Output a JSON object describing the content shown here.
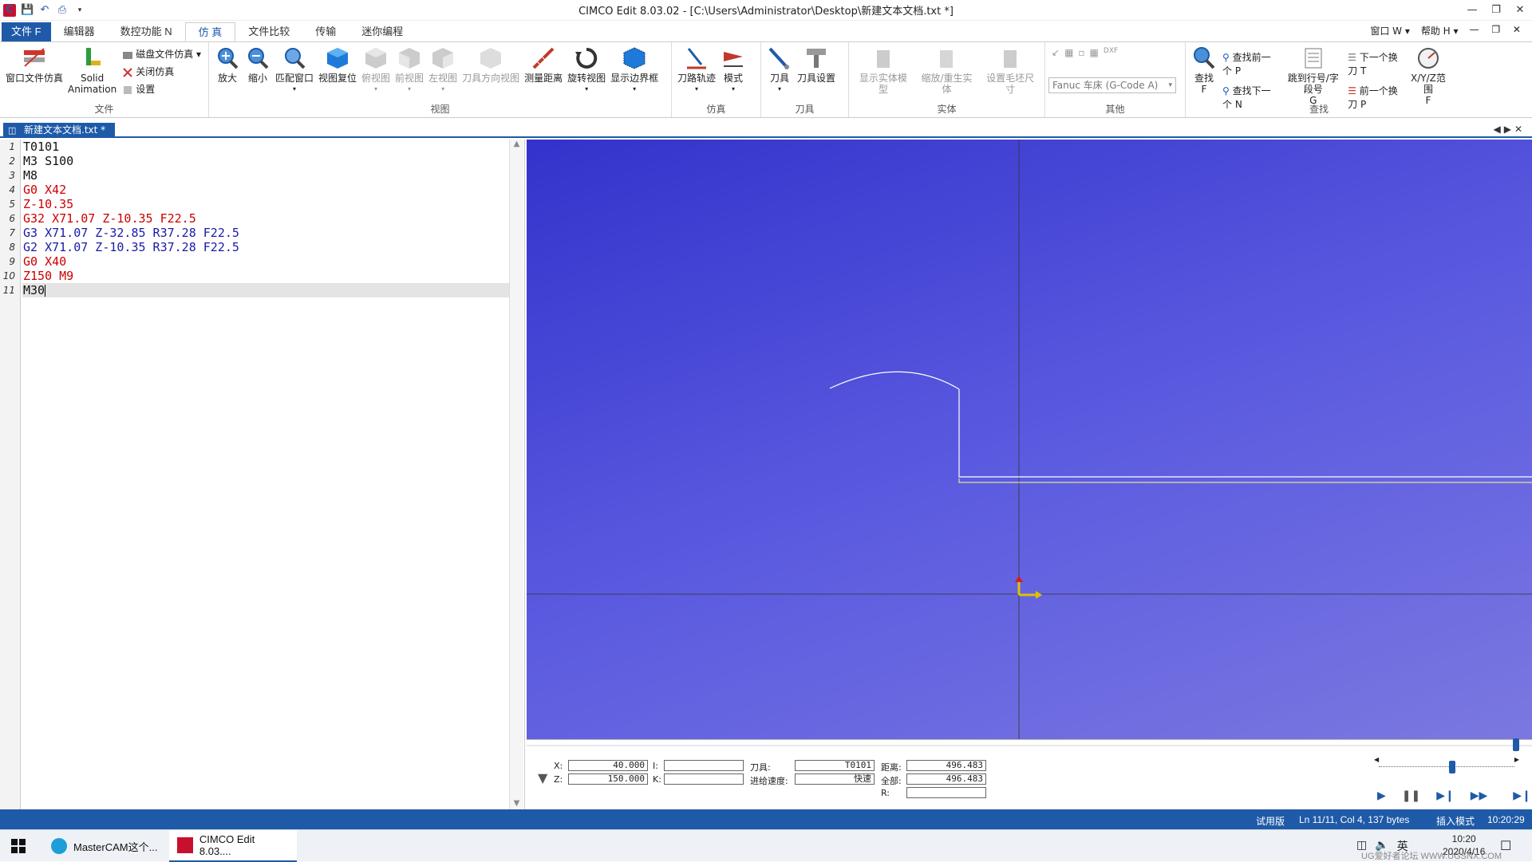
{
  "window": {
    "title": "CIMCO Edit 8.03.02 - [C:\\Users\\Administrator\\Desktop\\新建文本文档.txt *]",
    "logo": "C"
  },
  "ribbon_tabs": [
    "文件 F",
    "编辑器",
    "数控功能 N",
    "仿 真",
    "文件比较",
    "传输",
    "迷你编程"
  ],
  "ribbon_right": [
    "窗口 W",
    "帮助 H"
  ],
  "groups": {
    "file": {
      "label": "文件",
      "window_sim": "窗口文件仿真",
      "solid_1": "Solid",
      "solid_2": "Animation",
      "disk_sim": "磁盘文件仿真",
      "close_sim": "关闭仿真",
      "settings": "设置"
    },
    "view": {
      "label": "视图",
      "zoom_in": "放大",
      "zoom_out": "缩小",
      "fit_window": "匹配窗口",
      "view_reset": "视图复位",
      "top_view": "俯视图",
      "front_view": "前视图",
      "left_view": "左视图",
      "tool_dir_view": "刀具方向视图",
      "measure": "测量距离",
      "rotate": "旋转视图",
      "show_bounds": "显示边界框"
    },
    "sim": {
      "label": "仿真",
      "toolpath": "刀路轨迹",
      "mode": "模式"
    },
    "tool": {
      "label": "刀具",
      "tool": "刀具",
      "tool_settings": "刀具设置"
    },
    "solid": {
      "label": "实体",
      "show_model": "显示实体模型",
      "zoom_regen": "缩放/重生实体",
      "stock_size": "设置毛坯尺寸"
    },
    "other": {
      "label": "其他",
      "combo": "Fanuc 车床 (G-Code A)"
    },
    "find": {
      "label": "查找",
      "find": "查找",
      "find_key": "F",
      "find_prev": "查找前一个 P",
      "find_next": "查找下一个 N",
      "goto_1": "跳到行号/字段号",
      "goto_2": "G",
      "next_tool": "下一个换刀 T",
      "prev_tool": "前一个换刀 P",
      "range_1": "X/Y/Z范围",
      "range_2": "F"
    }
  },
  "doc_tab": {
    "label": "新建文本文档.txt *"
  },
  "editor": {
    "lines": [
      {
        "n": "1",
        "text": "T0101",
        "color": "black"
      },
      {
        "n": "2",
        "text": "M3 S100",
        "color": "black"
      },
      {
        "n": "3",
        "text": "M8",
        "color": "black"
      },
      {
        "n": "4",
        "text": "G0 X42",
        "color": "red"
      },
      {
        "n": "5",
        "text": "Z-10.35",
        "color": "red"
      },
      {
        "n": "6",
        "text": "G32 X71.07 Z-10.35 F22.5",
        "color": "red"
      },
      {
        "n": "7",
        "text": "G3 X71.07 Z-32.85 R37.28 F22.5",
        "color": "blue"
      },
      {
        "n": "8",
        "text": "G2 X71.07 Z-10.35 R37.28 F22.5",
        "color": "blue"
      },
      {
        "n": "9",
        "text": "G0 X40",
        "color": "red"
      },
      {
        "n": "10",
        "text": "Z150 M9",
        "color": "red"
      },
      {
        "n": "11",
        "text": "M30",
        "color": "black"
      }
    ]
  },
  "readout": {
    "x_label": "X:",
    "x_value": "40.000",
    "z_label": "Z:",
    "z_value": "150.000",
    "i_label": "I:",
    "i_value": "",
    "k_label": "K:",
    "k_value": "",
    "tool_label": "刀具:",
    "tool_value": "T0101",
    "feed_label": "进给速度:",
    "feed_value": "快速",
    "dist_label": "距离:",
    "dist_value": "496.483",
    "total_label": "全部:",
    "total_value": "496.483",
    "r_label": "R:",
    "r_value": ""
  },
  "statusbar": {
    "trial": "试用版",
    "pos": "Ln 11/11, Col 4, 137 bytes",
    "mode": "插入模式",
    "time": "10:20:29"
  },
  "taskbar": {
    "item1": "MasterCAM这个...",
    "item2": "CIMCO Edit 8.03....",
    "ime": "英",
    "clock_time": "10:20",
    "clock_date": "2020/4/16",
    "watermark": "UG爱好者论坛 WWW.UGSNX.COM"
  },
  "colors": {
    "accent": "#1e5aa8",
    "viewport_top": "#3333cc",
    "viewport_bottom": "#7b78e0",
    "path": "#ffffff",
    "code_red": "#cc0000",
    "code_blue": "#1a1aa8"
  }
}
